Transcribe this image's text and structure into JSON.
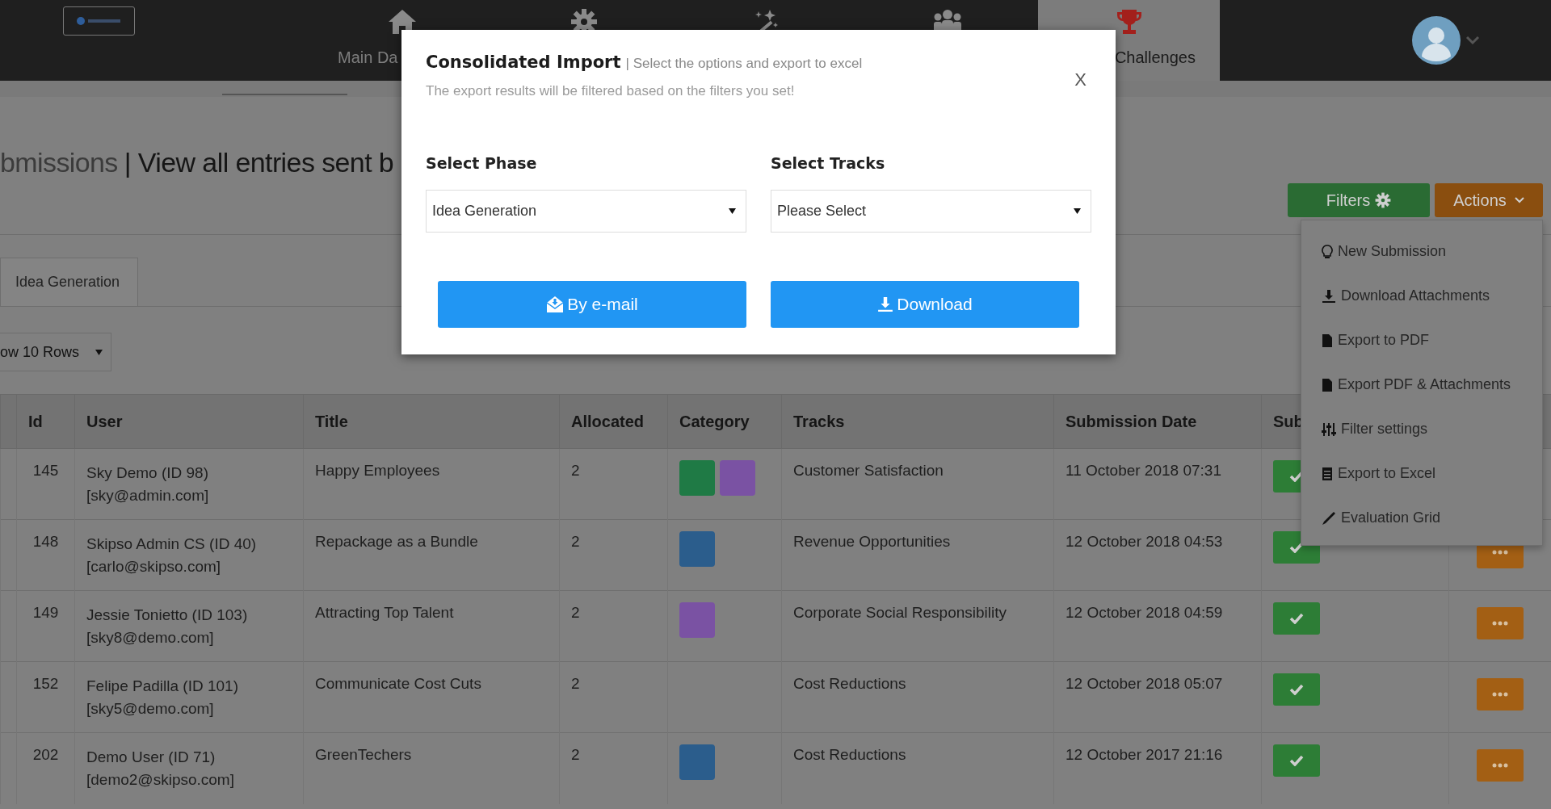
{
  "nav": {
    "items": [
      {
        "label": "Main Da",
        "selected": false
      },
      {
        "selected": false
      },
      {
        "selected": false
      },
      {
        "selected": false
      },
      {
        "label": "Challenges",
        "selected": true
      }
    ]
  },
  "page": {
    "title": "bmissions",
    "subtitle": "| View all entries sent b"
  },
  "phase_tabs": [
    {
      "label": "Idea Generation",
      "selected": true
    }
  ],
  "rows_select": {
    "value": "ow 10 Rows"
  },
  "toolbar": {
    "filters": "Filters",
    "actions": "Actions"
  },
  "actions_menu": [
    "New Submission",
    "Download Attachments",
    "Export to PDF",
    "Export PDF & Attachments",
    "Filter settings",
    "Export to Excel",
    "Evaluation Grid"
  ],
  "table": {
    "columns": [
      "Id",
      "User",
      "Title",
      "Allocated",
      "Category",
      "Tracks",
      "Submission Date",
      "Sub"
    ],
    "rows": [
      {
        "id": "145",
        "user": "Sky Demo (ID 98)",
        "email": "[sky@admin.com]",
        "title": "Happy Employees",
        "allocated": "2",
        "categories": [
          {
            "color": "#1f7a45"
          },
          {
            "color": "#7a52a3"
          }
        ],
        "tracks": "Customer Satisfaction",
        "date": "11 October 2018 07:31",
        "submitted": true,
        "more_button": false
      },
      {
        "id": "148",
        "user": "Skipso Admin CS (ID 40)",
        "email": "[carlo@skipso.com]",
        "title": "Repackage as a Bundle",
        "allocated": "2",
        "categories": [
          {
            "color": "#2b5d8c"
          }
        ],
        "tracks": "Revenue Opportunities",
        "date": "12 October 2018 04:53",
        "submitted": true,
        "more_button": true
      },
      {
        "id": "149",
        "user": "Jessie Tonietto (ID 103)",
        "email": "[sky8@demo.com]",
        "title": "Attracting Top Talent",
        "allocated": "2",
        "categories": [
          {
            "color": "#7a52a3"
          }
        ],
        "tracks": "Corporate Social Responsibility",
        "date": "12 October 2018 04:59",
        "submitted": true,
        "more_button": true
      },
      {
        "id": "152",
        "user": "Felipe Padilla (ID 101)",
        "email": "[sky5@demo.com]",
        "title": "Communicate Cost Cuts",
        "allocated": "2",
        "categories": [],
        "tracks": "Cost Reductions",
        "date": "12 October 2018 05:07",
        "submitted": true,
        "more_button": true
      },
      {
        "id": "202",
        "user": "Demo User (ID 71)",
        "email": "[demo2@skipso.com]",
        "title": "GreenTechers",
        "allocated": "2",
        "categories": [
          {
            "color": "#2b5d8c"
          }
        ],
        "tracks": "Cost Reductions",
        "date": "12 October 2017 21:16",
        "submitted": true,
        "more_button": true
      }
    ]
  },
  "modal": {
    "title": "Consolidated Import",
    "subtitle": "| Select the options and export to excel",
    "note": "The export results will be filtered based on the filters you set!",
    "close": "X",
    "fields": [
      {
        "label": "Select Phase",
        "value": "Idea Generation"
      },
      {
        "label": "Select Tracks",
        "value": "Please Select"
      }
    ],
    "buttons": [
      {
        "kind": "email",
        "label": "By e-mail"
      },
      {
        "kind": "download",
        "label": "Download"
      }
    ]
  }
}
